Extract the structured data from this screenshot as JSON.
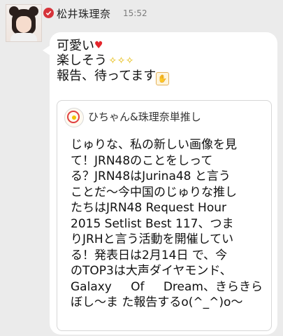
{
  "sender": {
    "name": "松井珠理奈",
    "time": "15:52"
  },
  "message": {
    "line1": "可愛い",
    "line2": "楽しそう",
    "line3": "報告、待ってます"
  },
  "quote": {
    "author": "ひちゃん&珠理奈単推し",
    "body_lines": [
      "じゅりな、私の新しい画像を見",
      "て！JRN48のことをしって",
      "る？JRN48はJurina48 と言う",
      "ことだ～今中国のじゅりな推し",
      "たちはJRN48 Request Hour",
      "2015 Setlist Best 117、つま",
      "りJRHと言う活動を開催してい",
      "る！発表日は2月14日 で、今",
      "のTOP3は大声ダイヤモンド、"
    ],
    "justified_line": [
      "Galaxy",
      "Of",
      "Dream、きらきら"
    ],
    "last_line": "ぼし～ま た報告するo(^_^)o～"
  },
  "colors": {
    "background": "#ebebeb",
    "bubble": "#ffffff",
    "verified": "#d6333a",
    "heart": "#e4262c",
    "sparkle": "#e4b800"
  },
  "icons": {
    "verified": "verified-check-icon",
    "heart": "heart-icon",
    "sparkles": "sparkles-icon",
    "hands": "raised-hands-icon"
  }
}
